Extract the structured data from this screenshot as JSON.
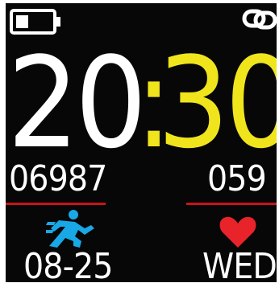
{
  "status": {
    "battery_icon": "battery-low-icon",
    "battery_level": 0.35,
    "connection_icon": "link-icon"
  },
  "time": {
    "hour": "20",
    "separator": ":",
    "minute": "30"
  },
  "stats": {
    "steps": "06987",
    "heart_rate": "059"
  },
  "footer": {
    "activity_icon": "runner-icon",
    "heart_icon": "heart-icon",
    "date": "08-25",
    "weekday": "WED"
  },
  "colors": {
    "background": "#080707",
    "time_hour": "#ffffff",
    "time_minute": "#f0e51c",
    "divider": "#c8141a",
    "runner": "#18a8e6",
    "heart": "#e8232a"
  }
}
